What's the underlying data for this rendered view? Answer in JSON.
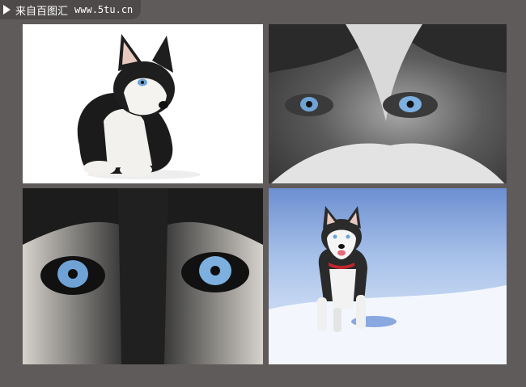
{
  "watermark": {
    "name": "来自百图汇",
    "site": "www.5tu.cn"
  },
  "images": [
    {
      "id": "puppy-sitting"
    },
    {
      "id": "husky-face-closeup"
    },
    {
      "id": "husky-eyes-macro"
    },
    {
      "id": "puppy-running-snow"
    }
  ],
  "colors": {
    "frame": "#5f5b5a",
    "watermark_bg": "#4e4a49",
    "eye_blue": "#6fa3d6"
  }
}
